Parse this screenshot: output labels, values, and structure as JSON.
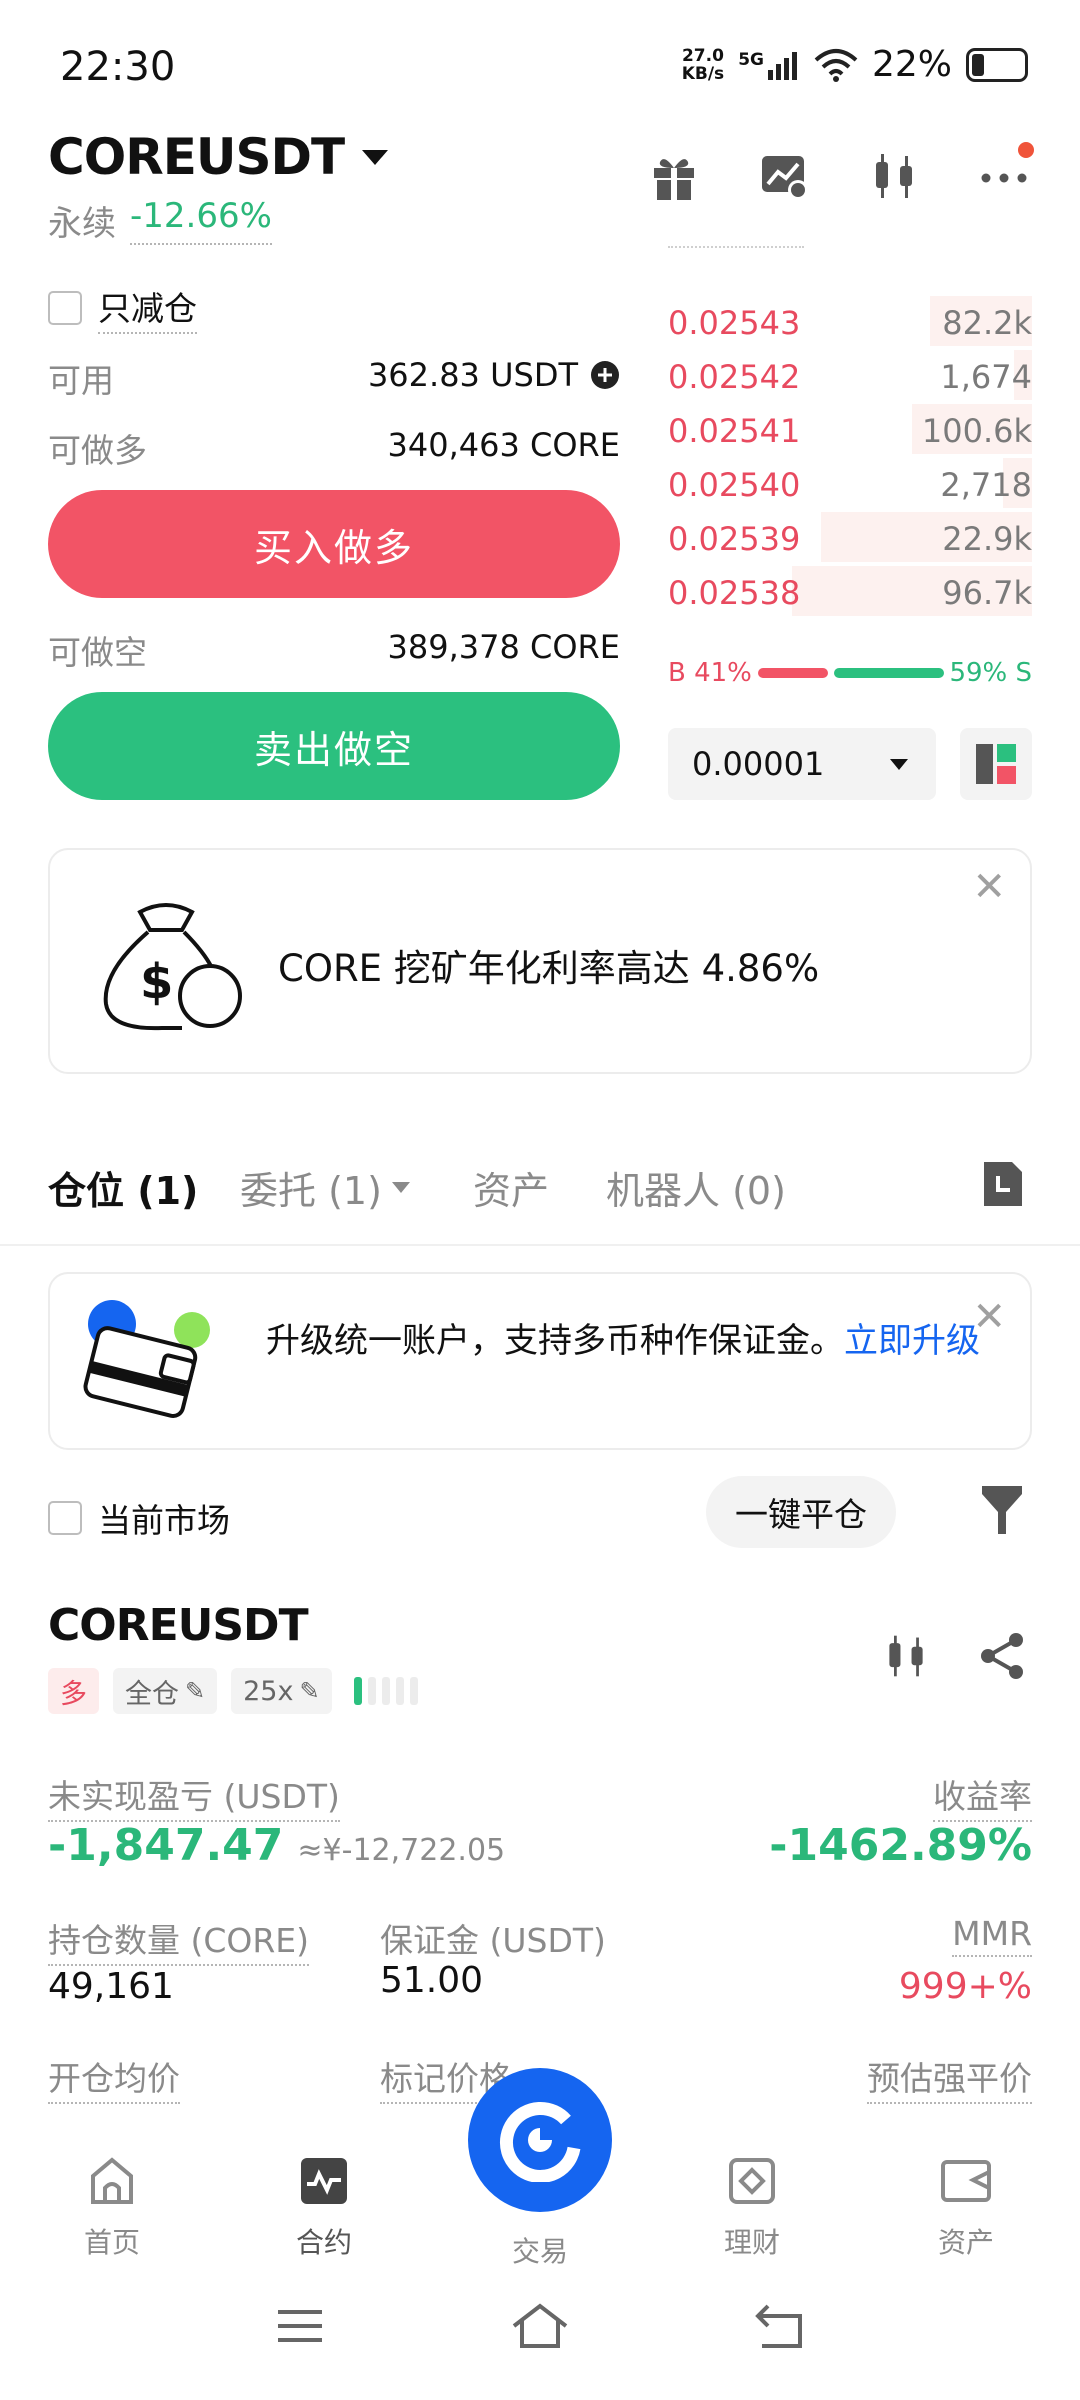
{
  "status_bar": {
    "time": "22:30",
    "net_speed_top": "27.0",
    "net_speed_bottom": "KB/s",
    "network": "5G",
    "battery": "22%"
  },
  "header": {
    "symbol": "COREUSDT",
    "contract_type": "永续",
    "change": "-12.66%"
  },
  "header_icons": [
    "gift-icon",
    "chart-settings-icon",
    "candlestick-icon",
    "more-icon"
  ],
  "form": {
    "reduce_only_label": "只减仓",
    "available_label": "可用",
    "available_value": "362.83 USDT",
    "can_long_label": "可做多",
    "can_long_value": "340,463 CORE",
    "buy_button": "买入做多",
    "can_short_label": "可做空",
    "can_short_value": "389,378 CORE",
    "sell_button": "卖出做空"
  },
  "orderbook": {
    "asks": [
      {
        "price": "0.02543",
        "qty": "82.2k",
        "depth": 0.28
      },
      {
        "price": "0.02542",
        "qty": "1,674",
        "depth": 0.05
      },
      {
        "price": "0.02541",
        "qty": "100.6k",
        "depth": 0.33
      },
      {
        "price": "0.02540",
        "qty": "2,718",
        "depth": 0.08
      },
      {
        "price": "0.02539",
        "qty": "22.9k",
        "depth": 0.58
      },
      {
        "price": "0.02538",
        "qty": "96.7k",
        "depth": 0.66
      }
    ],
    "buy_ratio_label": "B 41%",
    "sell_ratio_label": "59% S",
    "buy_ratio": 0.41,
    "precision": "0.00001"
  },
  "promo": {
    "text": "CORE 挖矿年化利率高达 4.86%"
  },
  "tabs": {
    "positions": "仓位 (1)",
    "orders": "委托 (1)",
    "assets": "资产",
    "bots": "机器人 (0)"
  },
  "upgrade_banner": {
    "text": "升级统一账户，支持多币种作保证金。",
    "link": "立即升级"
  },
  "filter_row": {
    "current_market": "当前市场",
    "close_all": "一键平仓"
  },
  "position": {
    "symbol": "COREUSDT",
    "side": "多",
    "margin_mode": "全仓",
    "leverage": "25x",
    "unrealized_pnl_label": "未实现盈亏 (USDT)",
    "unrealized_pnl": "-1,847.47",
    "unrealized_pnl_cny": "≈¥-12,722.05",
    "roe_label": "收益率",
    "roe": "-1462.89%",
    "size_label": "持仓数量 (CORE)",
    "size": "49,161",
    "margin_label": "保证金 (USDT)",
    "margin": "51.00",
    "mmr_label": "MMR",
    "mmr": "999+%",
    "entry_label": "开仓均价",
    "mark_label": "标记价格",
    "liq_label": "预估强平价"
  },
  "bottom_nav": {
    "home": "首页",
    "futures": "合约",
    "trade": "交易",
    "earn": "理财",
    "assets": "资产"
  },
  "colors": {
    "green": "#2bb77a",
    "red": "#e84a5f",
    "blue": "#1565f0"
  }
}
